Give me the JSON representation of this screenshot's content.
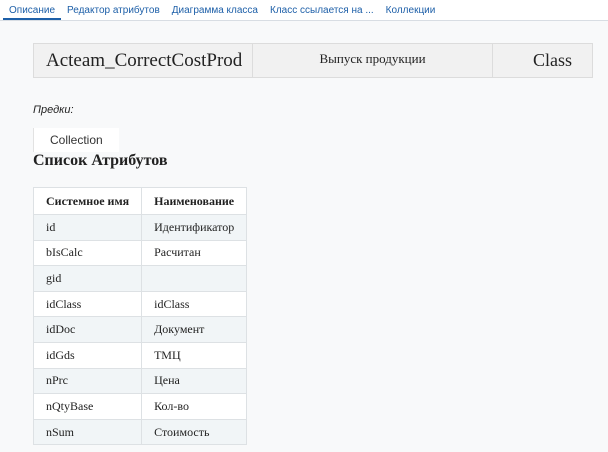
{
  "tabs": [
    {
      "label": "Описание"
    },
    {
      "label": "Редактор атрибутов"
    },
    {
      "label": "Диаграмма класса"
    },
    {
      "label": "Класс ссылается на ..."
    },
    {
      "label": "Коллекции"
    }
  ],
  "header": {
    "name": "Acteam_CorrectCostProd",
    "caption": "Выпуск продукции",
    "kind": "Class"
  },
  "ancestors": {
    "label": "Предки:",
    "items": [
      "Collection"
    ]
  },
  "attributes": {
    "title": "Список Атрибутов",
    "columns": [
      "Системное имя",
      "Наименование"
    ],
    "rows": [
      [
        "id",
        "Идентификатор"
      ],
      [
        "bIsCalc",
        "Расчитан"
      ],
      [
        "gid",
        ""
      ],
      [
        "idClass",
        "idClass"
      ],
      [
        "idDoc",
        "Документ"
      ],
      [
        "idGds",
        "ТМЦ"
      ],
      [
        "nPrc",
        "Цена"
      ],
      [
        "nQtyBase",
        "Кол-во"
      ],
      [
        "nSum",
        "Стоимость"
      ]
    ]
  }
}
